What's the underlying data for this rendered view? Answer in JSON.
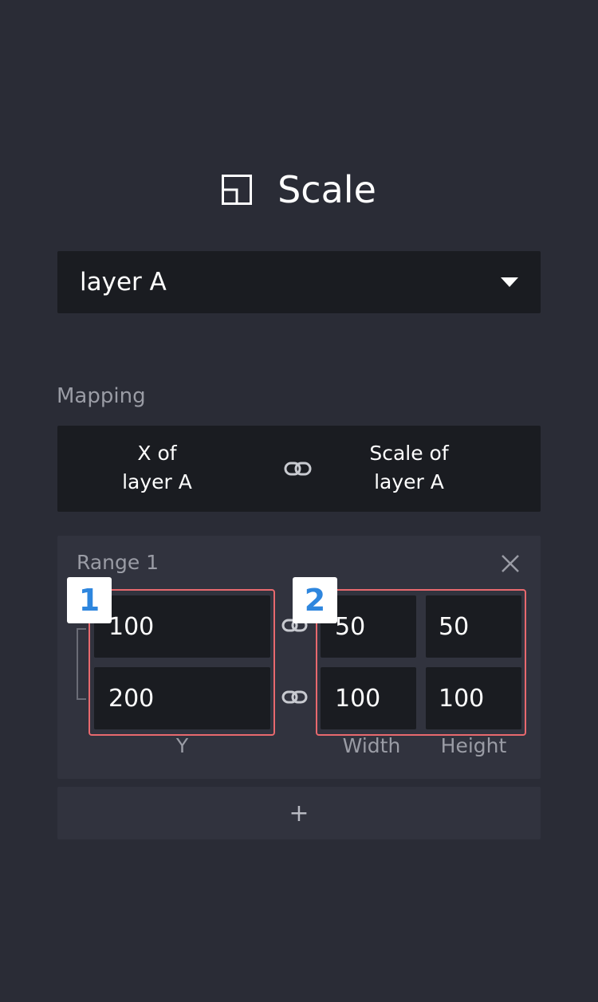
{
  "header": {
    "icon": "scale-icon",
    "title": "Scale"
  },
  "layer_select": {
    "value": "layer A"
  },
  "mapping": {
    "label": "Mapping",
    "source": [
      "X of",
      "layer A"
    ],
    "target": [
      "Scale of",
      "layer A"
    ],
    "link_icon": "link-icon"
  },
  "range": {
    "title": "Range 1",
    "y_values": [
      "100",
      "200"
    ],
    "width_values": [
      "50",
      "100"
    ],
    "height_values": [
      "50",
      "100"
    ],
    "labels": {
      "y": "Y",
      "width": "Width",
      "height": "Height"
    }
  },
  "annotations": {
    "badge_1": "1",
    "badge_2": "2",
    "highlight_color": "#e8696e",
    "badge_text_color": "#2e86de"
  },
  "add_button": {
    "label": "+"
  }
}
